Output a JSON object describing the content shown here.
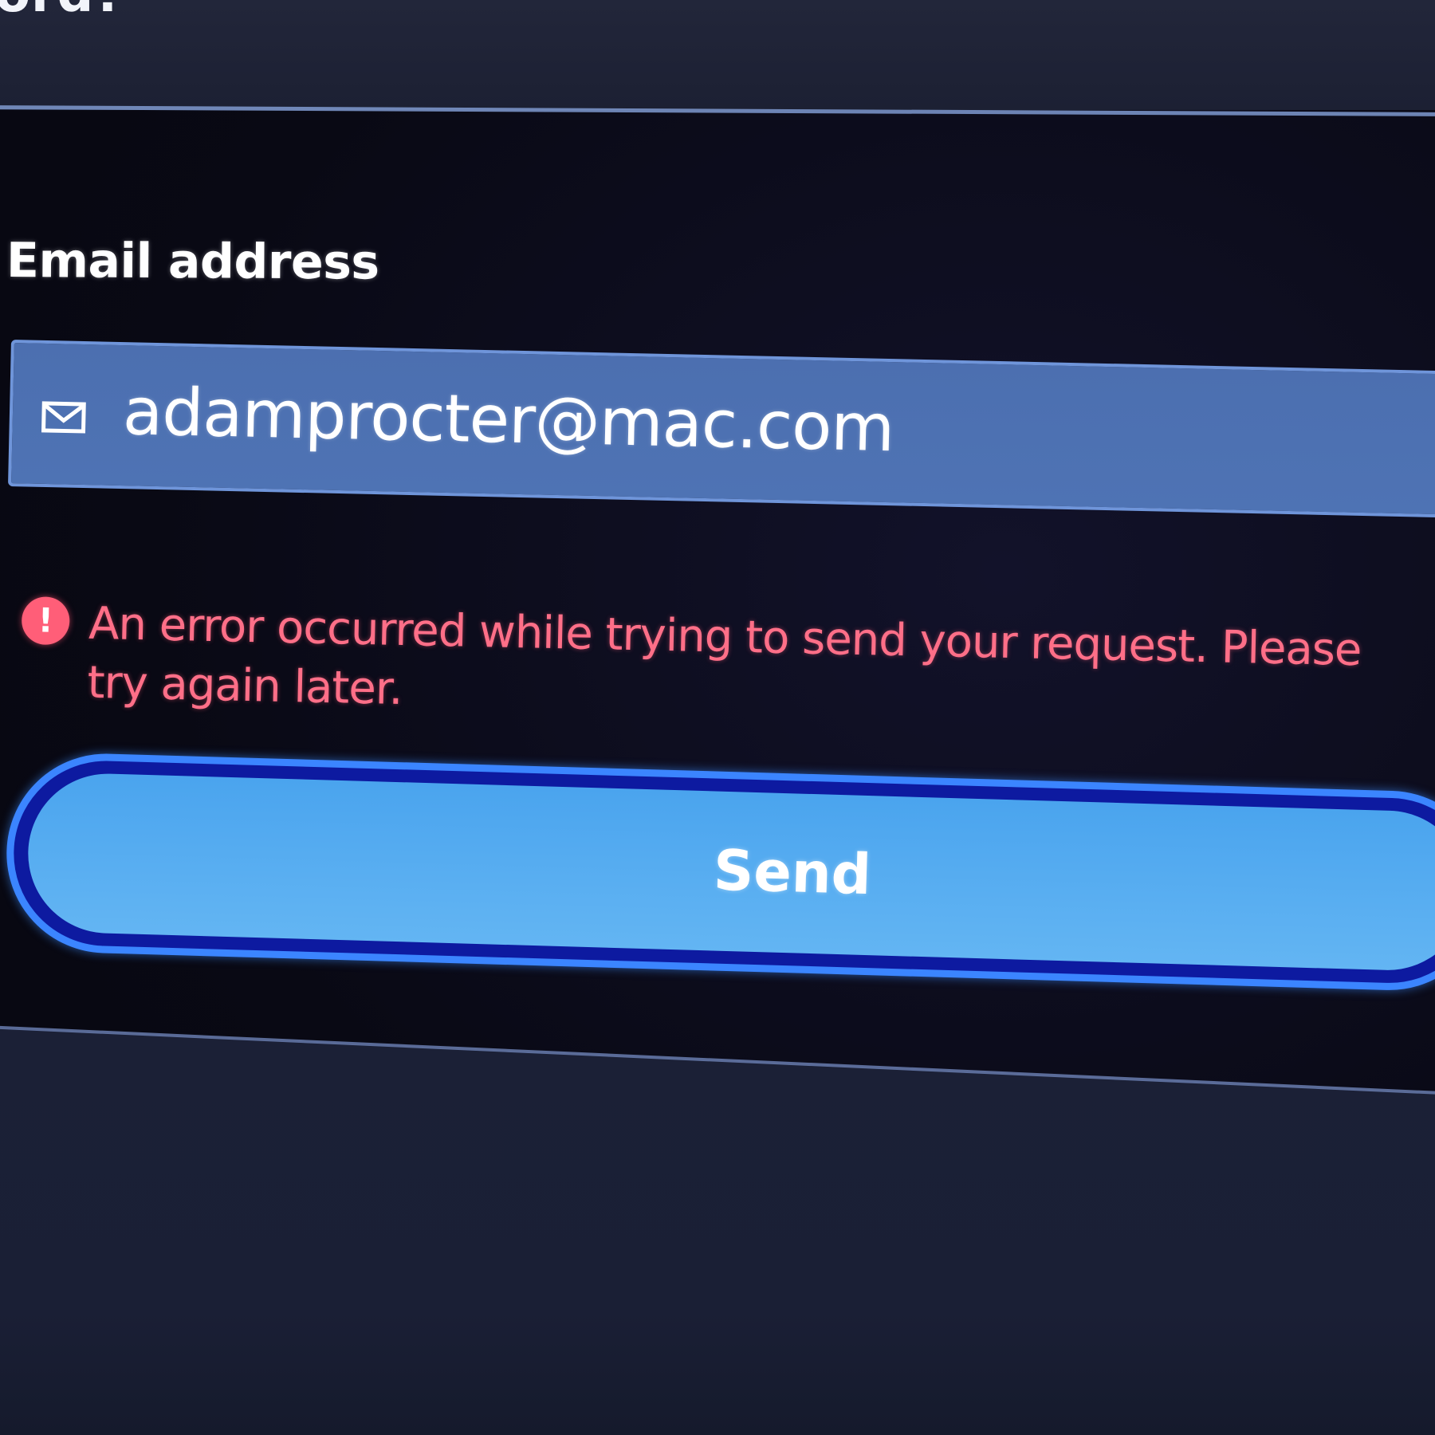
{
  "header": {
    "title_fragment": "ord?"
  },
  "form": {
    "email_label": "Email address",
    "email_value": "adamprocter@mac.com",
    "email_icon": "mail-icon",
    "error_icon": "alert-circle-icon",
    "error_message": "An error occurred while trying to send your request. Please try again later.",
    "submit_label": "Send"
  },
  "colors": {
    "background": "#0c0c1a",
    "field_fill": "#4e73b4",
    "error_text": "#ff6f88",
    "button_fill": "#5aaef0",
    "button_ring": "#3b85ff"
  }
}
